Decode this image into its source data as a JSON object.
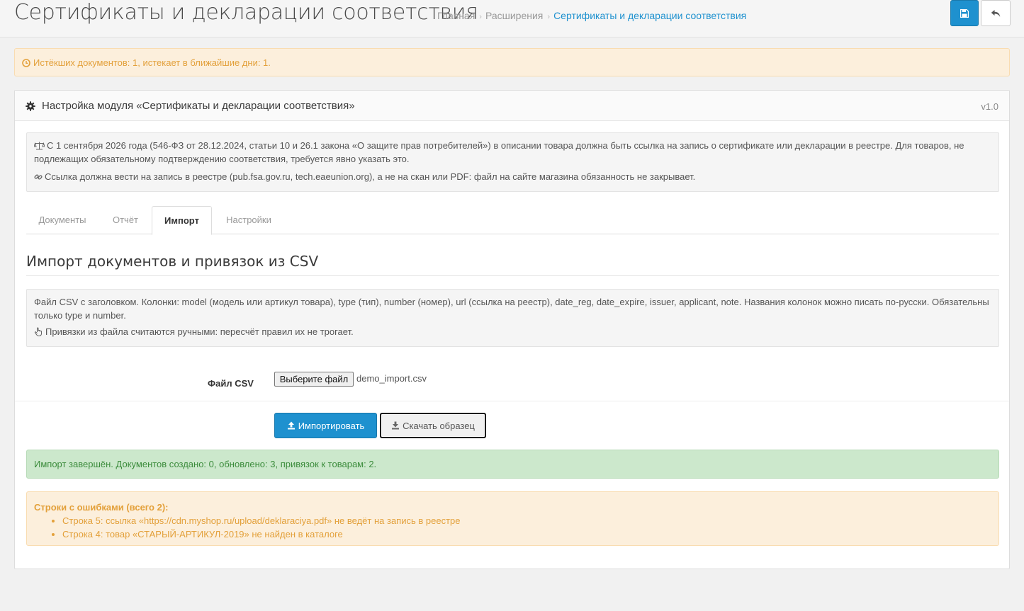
{
  "header": {
    "title": "Сертификаты и декларации соответствия",
    "breadcrumbs": [
      {
        "label": "Главная"
      },
      {
        "label": "Расширения"
      },
      {
        "label": "Сертификаты и декларации соответствия"
      }
    ],
    "save_icon": "save-icon",
    "back_icon": "reply-icon"
  },
  "expire_alert": {
    "icon": "clock-icon",
    "text": "Истёкших документов: 1, истекает в ближайшие дни: 1."
  },
  "panel": {
    "title": "Настройка модуля «Сертификаты и декларации соответствия»",
    "version": "v1.0",
    "law_notice": {
      "line1": "С 1 сентября 2026 года (546-ФЗ от 28.12.2024, статьи 10 и 26.1 закона «О защите прав потребителей») в описании товара должна быть ссылка на запись о сертификате или декларации в реестре. Для товаров, не подлежащих обязательному подтверждению соответствия, требуется явно указать это.",
      "line2": "Ссылка должна вести на запись в реестре (pub.fsa.gov.ru, tech.eaeunion.org), а не на скан или PDF: файл на сайте магазина обязанность не закрывает."
    },
    "tabs": [
      {
        "label": "Документы"
      },
      {
        "label": "Отчёт"
      },
      {
        "label": "Импорт"
      },
      {
        "label": "Настройки"
      }
    ],
    "active_tab": "Импорт"
  },
  "import": {
    "heading": "Импорт документов и привязок из CSV",
    "info_line1": "Файл CSV с заголовком. Колонки: model (модель или артикул товара), type (тип), number (номер), url (ссылка на реестр), date_reg, date_expire, issuer, applicant, note. Названия колонок можно писать по-русски. Обязательны только type и number.",
    "info_line2": "Привязки из файла считаются ручными: пересчёт правил их не трогает.",
    "file_label": "Файл CSV",
    "file_button": "Выберите файл",
    "file_name": "demo_import.csv",
    "import_button": "Импортировать",
    "sample_button": "Скачать образец",
    "success": "Импорт завершён. Документов создано: 0, обновлено: 3, привязок к товарам: 2.",
    "errors_title": "Строки с ошибками (всего 2):",
    "errors": [
      "Строка 5: ссылка «https://cdn.myshop.ru/upload/deklaraciya.pdf» не ведёт на запись в реестре",
      "Строка 4: товар «СТАРЫЙ-АРТИКУЛ-2019» не найден в каталоге"
    ]
  },
  "colors": {
    "primary": "#1e91cf",
    "warning_bg": "#fcefdc",
    "warning_text": "#e3a03a",
    "success_bg": "#cce8cc",
    "success_text": "#3c8c3c"
  }
}
